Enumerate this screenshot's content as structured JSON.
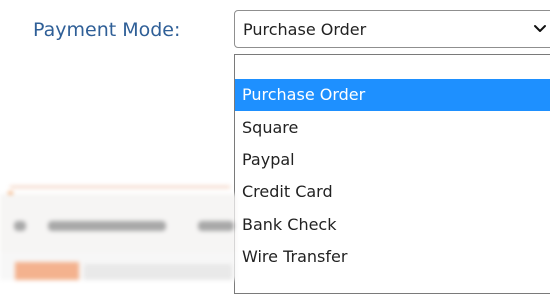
{
  "payment_mode": {
    "label": "Payment Mode:",
    "selected_value": "Purchase Order",
    "options": [
      {
        "label": ""
      },
      {
        "label": "Purchase Order",
        "selected": true
      },
      {
        "label": "Square"
      },
      {
        "label": "Paypal"
      },
      {
        "label": "Credit Card"
      },
      {
        "label": "Bank Check"
      },
      {
        "label": "Wire Transfer"
      }
    ]
  },
  "colors": {
    "label_text": "#2f5f97",
    "selected_option_bg": "#1e90ff",
    "selected_option_text": "#ffffff"
  },
  "icons": {
    "dropdown_toggle": "chevron-down-icon"
  }
}
